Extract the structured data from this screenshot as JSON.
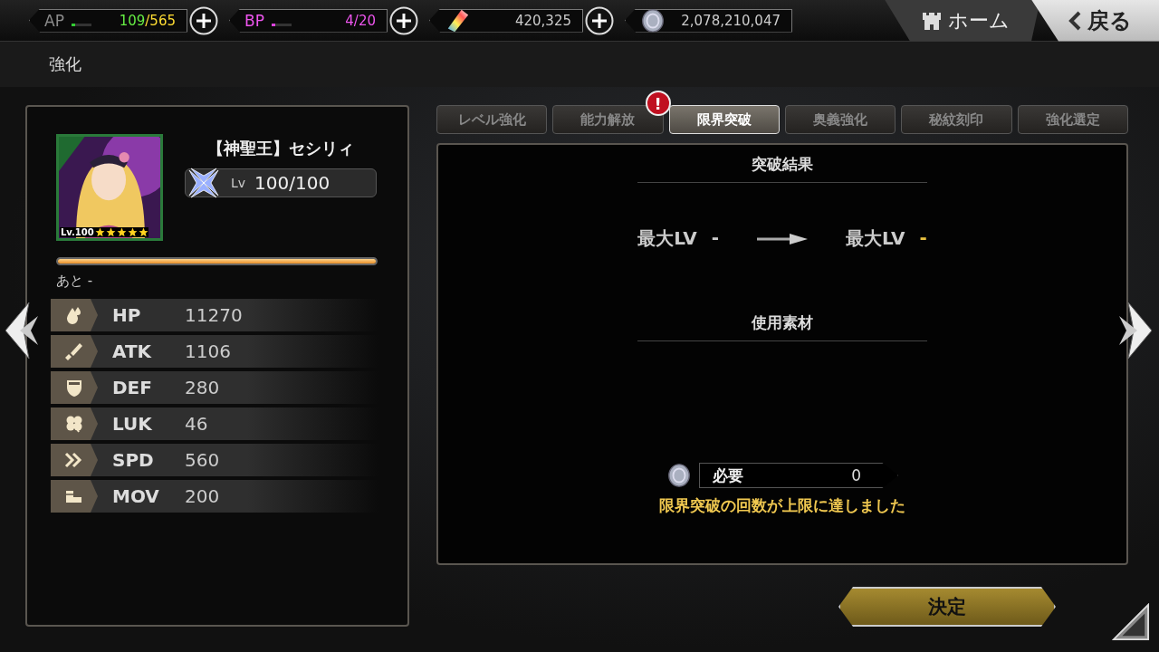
{
  "top_bar": {
    "resources": [
      {
        "kind": "ap",
        "label": "AP",
        "current": "109",
        "max": "/565",
        "level": 0.19,
        "plus": true
      },
      {
        "kind": "bp",
        "label": "BP",
        "current": "4/20",
        "level": 0.2,
        "plus": true
      },
      {
        "kind": "crystal",
        "current": "420,325",
        "plus": true
      },
      {
        "kind": "coin",
        "current": "2,078,210,047",
        "plus": false
      }
    ],
    "home": "ホーム",
    "back": "戻る"
  },
  "page_title": "強化",
  "character": {
    "name": "【神聖王】セシリィ",
    "portrait_level": "Lv.100",
    "stars": 5,
    "rank_label": "Lv",
    "rank_value": "100/100",
    "exp_gauge": {
      "level": 1.0
    },
    "remaining": "あと -",
    "stats": [
      {
        "kind": "hp",
        "label": "HP",
        "value": "11270"
      },
      {
        "kind": "atk",
        "label": "ATK",
        "value": "1106"
      },
      {
        "kind": "def",
        "label": "DEF",
        "value": "280"
      },
      {
        "kind": "luk",
        "label": "LUK",
        "value": "46"
      },
      {
        "kind": "spd",
        "label": "SPD",
        "value": "560"
      },
      {
        "kind": "mov",
        "label": "MOV",
        "value": "200"
      }
    ]
  },
  "tabs": [
    {
      "label": "レベル強化",
      "selected": false,
      "alert": false
    },
    {
      "label": "能力解放",
      "selected": false,
      "alert": true
    },
    {
      "label": "限界突破",
      "selected": true,
      "alert": false
    },
    {
      "label": "奥義強化",
      "selected": false,
      "alert": false
    },
    {
      "label": "秘紋刻印",
      "selected": false,
      "alert": false
    },
    {
      "label": "強化選定",
      "selected": false,
      "alert": false
    }
  ],
  "alert_mark": "!",
  "result": {
    "heading": "突破結果",
    "before_label": "最大LV",
    "before_value": "-",
    "after_label": "最大LV",
    "after_value": "-",
    "materials_heading": "使用素材",
    "cost_label": "必要",
    "cost_value": "0",
    "message": "限界突破の回数が上限に達しました"
  },
  "confirm_button": "決定"
}
